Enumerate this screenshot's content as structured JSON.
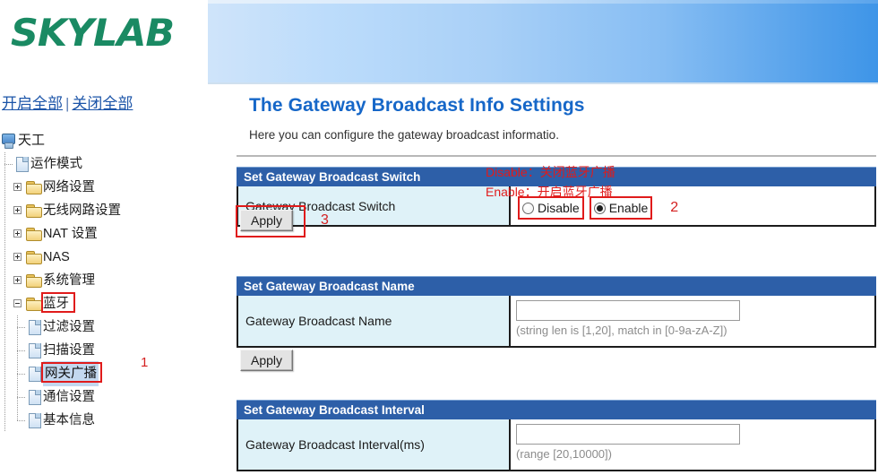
{
  "brand": {
    "logo_text": "SKYLAB",
    "logo_color": "#1a8a63"
  },
  "sidebar": {
    "expand_all": "开启全部",
    "separator": "|",
    "collapse_all": "关闭全部",
    "tree": [
      {
        "label": "天工",
        "icon": "computer-icon",
        "type": "root",
        "level": 0
      },
      {
        "label": "运作模式",
        "icon": "page-icon",
        "type": "leaf",
        "level": 1
      },
      {
        "label": "网络设置",
        "icon": "folder-icon",
        "type": "folder",
        "level": 1,
        "expander": "plus"
      },
      {
        "label": "无线网路设置",
        "icon": "folder-icon",
        "type": "folder",
        "level": 1,
        "expander": "plus"
      },
      {
        "label": "NAT 设置",
        "icon": "folder-icon",
        "type": "folder",
        "level": 1,
        "expander": "plus"
      },
      {
        "label": "NAS",
        "icon": "folder-icon",
        "type": "folder",
        "level": 1,
        "expander": "plus"
      },
      {
        "label": "系统管理",
        "icon": "folder-icon",
        "type": "folder",
        "level": 1,
        "expander": "plus"
      },
      {
        "label": "蓝牙",
        "icon": "folder-icon",
        "type": "folder",
        "level": 1,
        "expander": "minus",
        "highlighted": true
      },
      {
        "label": "过滤设置",
        "icon": "page-icon",
        "type": "leaf",
        "level": 2
      },
      {
        "label": "扫描设置",
        "icon": "page-icon",
        "type": "leaf",
        "level": 2
      },
      {
        "label": "网关广播",
        "icon": "page-icon",
        "type": "leaf",
        "level": 2,
        "selected": true,
        "highlighted": true
      },
      {
        "label": "通信设置",
        "icon": "page-icon",
        "type": "leaf",
        "level": 2
      },
      {
        "label": "基本信息",
        "icon": "page-icon",
        "type": "leaf",
        "level": 2
      }
    ],
    "annotation_1": "1"
  },
  "main": {
    "title": "The Gateway Broadcast Info Settings",
    "description": "Here you can configure the gateway broadcast informatio.",
    "annotations": {
      "disable_note": "Disable：关闭蓝牙广播",
      "enable_note": "Enable：开启蓝牙广播",
      "radio_num": "2",
      "apply_num": "3"
    },
    "sections": [
      {
        "header": "Set Gateway Broadcast Switch",
        "field_label": "Gateway Broadcast Switch",
        "control": "radio",
        "options": [
          {
            "label": "Disable",
            "checked": false
          },
          {
            "label": "Enable",
            "checked": true
          }
        ],
        "apply_label": "Apply"
      },
      {
        "header": "Set Gateway Broadcast Name",
        "field_label": "Gateway Broadcast Name",
        "control": "text",
        "value": "",
        "hint": "(string len is [1,20], match in [0-9a-zA-Z])",
        "apply_label": "Apply"
      },
      {
        "header": "Set Gateway Broadcast Interval",
        "field_label": "Gateway Broadcast Interval(ms)",
        "control": "text",
        "value": "",
        "hint": "(range [20,10000])"
      }
    ]
  }
}
